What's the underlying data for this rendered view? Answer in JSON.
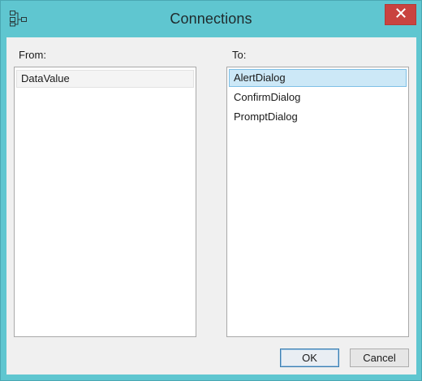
{
  "window": {
    "title": "Connections"
  },
  "from": {
    "label": "From:",
    "items": [
      "DataValue"
    ]
  },
  "to": {
    "label": "To:",
    "items": [
      "AlertDialog",
      "ConfirmDialog",
      "PromptDialog"
    ]
  },
  "buttons": {
    "ok": "OK",
    "cancel": "Cancel"
  },
  "icons": {
    "app": "connections-icon",
    "close": "close-icon"
  },
  "colors": {
    "frame": "#5fc6d0",
    "close_button": "#c9433f",
    "selection": "#cce8f7"
  }
}
